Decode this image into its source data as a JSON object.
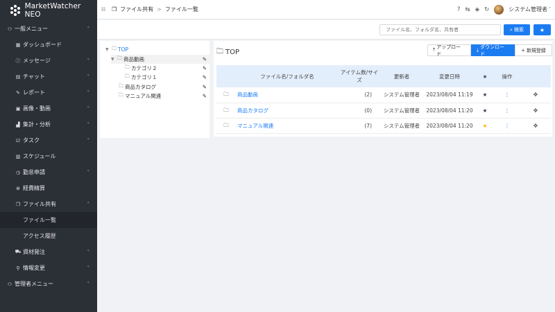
{
  "app": {
    "name": "MarketWatcher NEO"
  },
  "sidebar": {
    "items": [
      {
        "label": "一般メニュー",
        "icon": "user-group-icon",
        "chevron": "˄"
      },
      {
        "label": "ダッシュボード",
        "icon": "grid-icon",
        "chevron": ""
      },
      {
        "label": "メッセージ",
        "icon": "info-circle-icon",
        "chevron": "˅"
      },
      {
        "label": "チャット",
        "icon": "chat-icon",
        "chevron": "˅"
      },
      {
        "label": "レポート",
        "icon": "pen-icon",
        "chevron": "˅"
      },
      {
        "label": "画像・動画",
        "icon": "image-icon",
        "chevron": "˅"
      },
      {
        "label": "集計・分析",
        "icon": "chart-icon",
        "chevron": "˅"
      },
      {
        "label": "タスク",
        "icon": "task-icon",
        "chevron": "˅"
      },
      {
        "label": "スケジュール",
        "icon": "calendar-icon",
        "chevron": ""
      },
      {
        "label": "勤怠申請",
        "icon": "clock-icon",
        "chevron": "˅"
      },
      {
        "label": "経費精算",
        "icon": "yen-icon",
        "chevron": ""
      },
      {
        "label": "ファイル共有",
        "icon": "folder-share-icon",
        "chevron": "˄"
      },
      {
        "label": "ファイル一覧",
        "icon": "",
        "chevron": ""
      },
      {
        "label": "アクセス履歴",
        "icon": "",
        "chevron": ""
      },
      {
        "label": "資材発注",
        "icon": "cart-icon",
        "chevron": "˅"
      },
      {
        "label": "情報変更",
        "icon": "user-icon",
        "chevron": "˅"
      },
      {
        "label": "管理者メニュー",
        "icon": "admin-icon",
        "chevron": "˅"
      }
    ]
  },
  "header": {
    "breadcrumb": [
      "ファイル共有",
      "ファイル一覧"
    ],
    "user_name": "システム管理者"
  },
  "search": {
    "placeholder": "ファイル名、フォルダ名、共有者",
    "button_label": "検索"
  },
  "tree": {
    "root": "TOP",
    "nodes": [
      "商品動画",
      "カテゴリ２",
      "カテゴリ１",
      "商品カタログ",
      "マニュアル関連"
    ]
  },
  "main": {
    "title": "TOP",
    "upload_label": "アップロード",
    "download_label": "ダウンロード",
    "new_label": "新規登録"
  },
  "table": {
    "headers": [
      "ファイル名/フォルダ名",
      "アイテム数/サイズ",
      "更新者",
      "変更日時",
      "★",
      "操作"
    ],
    "rows": [
      {
        "name": "商品動画",
        "count": "(2)",
        "updater": "システム管理者",
        "date": "2023/08/04 11:19",
        "favorite": false
      },
      {
        "name": "商品カタログ",
        "count": "(0)",
        "updater": "システム管理者",
        "date": "2023/08/04 11:20",
        "favorite": false
      },
      {
        "name": "マニュアル関連",
        "count": "(7)",
        "updater": "システム管理者",
        "date": "2023/08/04 11:20",
        "favorite": true
      }
    ]
  },
  "colors": {
    "sidebar_bg": "#2b2f36",
    "accent": "#1b7cf2",
    "header_row_bg": "#e3eefc",
    "star_gold": "#f5b400"
  }
}
